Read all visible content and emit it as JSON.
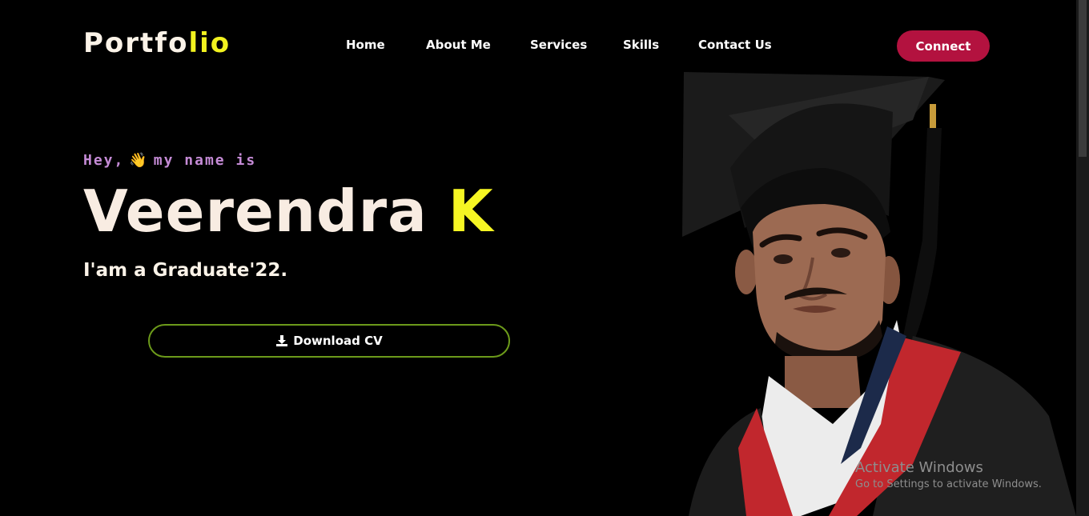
{
  "header": {
    "logo_main": "Portfo",
    "logo_accent": "lio",
    "nav": [
      {
        "label": "Home"
      },
      {
        "label": "About Me"
      },
      {
        "label": "Services"
      },
      {
        "label": "Skills"
      },
      {
        "label": "Contact Us"
      }
    ],
    "connect_label": "Connect"
  },
  "hero": {
    "greeting_before": "Hey,",
    "greeting_after": "my name is",
    "wave_emoji": "👋",
    "name_main": "Veerendra ",
    "name_accent": "K",
    "tagline": "I'am a Graduate'22.",
    "download_label": "Download CV",
    "portrait_icon": "graduate-portrait"
  },
  "watermark": {
    "title": "Activate Windows",
    "subtitle": "Go to Settings to activate Windows."
  },
  "colors": {
    "background": "#000000",
    "accent_yellow": "#f6f623",
    "connect_red": "#b3123f",
    "greeting_purple": "#c58bd6",
    "download_border": "#6c9a1a"
  }
}
